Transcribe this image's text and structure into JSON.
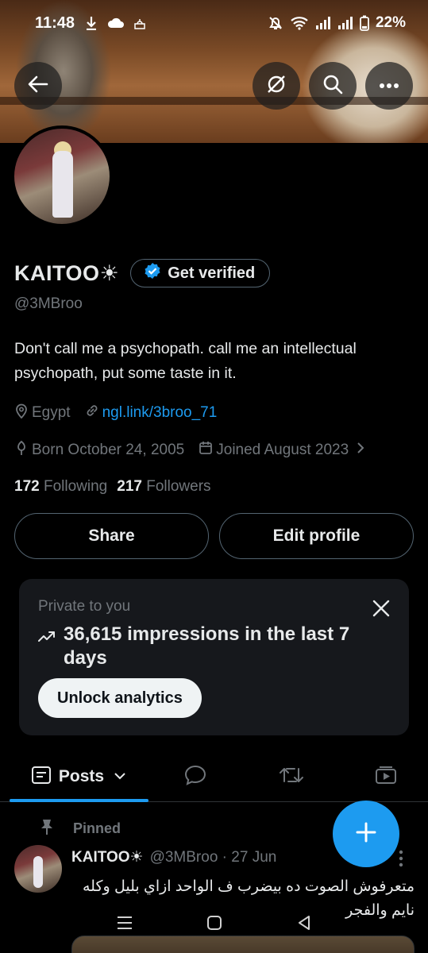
{
  "status_bar": {
    "time": "11:48",
    "battery": "22%"
  },
  "profile": {
    "display_name": "KAITOO☀",
    "get_verified_label": "Get verified",
    "handle": "@3MBroo",
    "bio": "Don't call me a psychopath. call me an intellectual psychopath, put some taste in it.",
    "location": "Egypt",
    "website": "ngl.link/3broo_71",
    "birthday": "Born October 24, 2005",
    "joined": "Joined August 2023",
    "following_count": "172",
    "following_label": "Following",
    "followers_count": "217",
    "followers_label": "Followers",
    "share_label": "Share",
    "edit_profile_label": "Edit profile"
  },
  "analytics_card": {
    "label": "Private to you",
    "headline": "36,615 impressions in the last 7 days",
    "button_label": "Unlock analytics"
  },
  "tabs": {
    "active_label": "Posts"
  },
  "pinned_post": {
    "pinned_label": "Pinned",
    "author_name": "KAITOO☀",
    "author_handle": "@3MBroo · 27 Jun",
    "text": "متعرفوش الصوت ده بيضرب ف الواحد ازاي بليل وكله نايم والفجر"
  },
  "colors": {
    "accent": "#1d9bf0",
    "background": "#000000",
    "card": "#16181c",
    "muted": "#71767b"
  },
  "icons": [
    "back-arrow-icon",
    "grok-icon",
    "search-icon",
    "more-icon",
    "verified-badge-icon",
    "location-icon",
    "link-icon",
    "birthday-icon",
    "calendar-icon",
    "chevron-right-icon",
    "close-icon",
    "trend-icon",
    "posts-icon",
    "replies-icon",
    "reposts-icon",
    "media-icon",
    "pin-icon",
    "plus-icon"
  ]
}
